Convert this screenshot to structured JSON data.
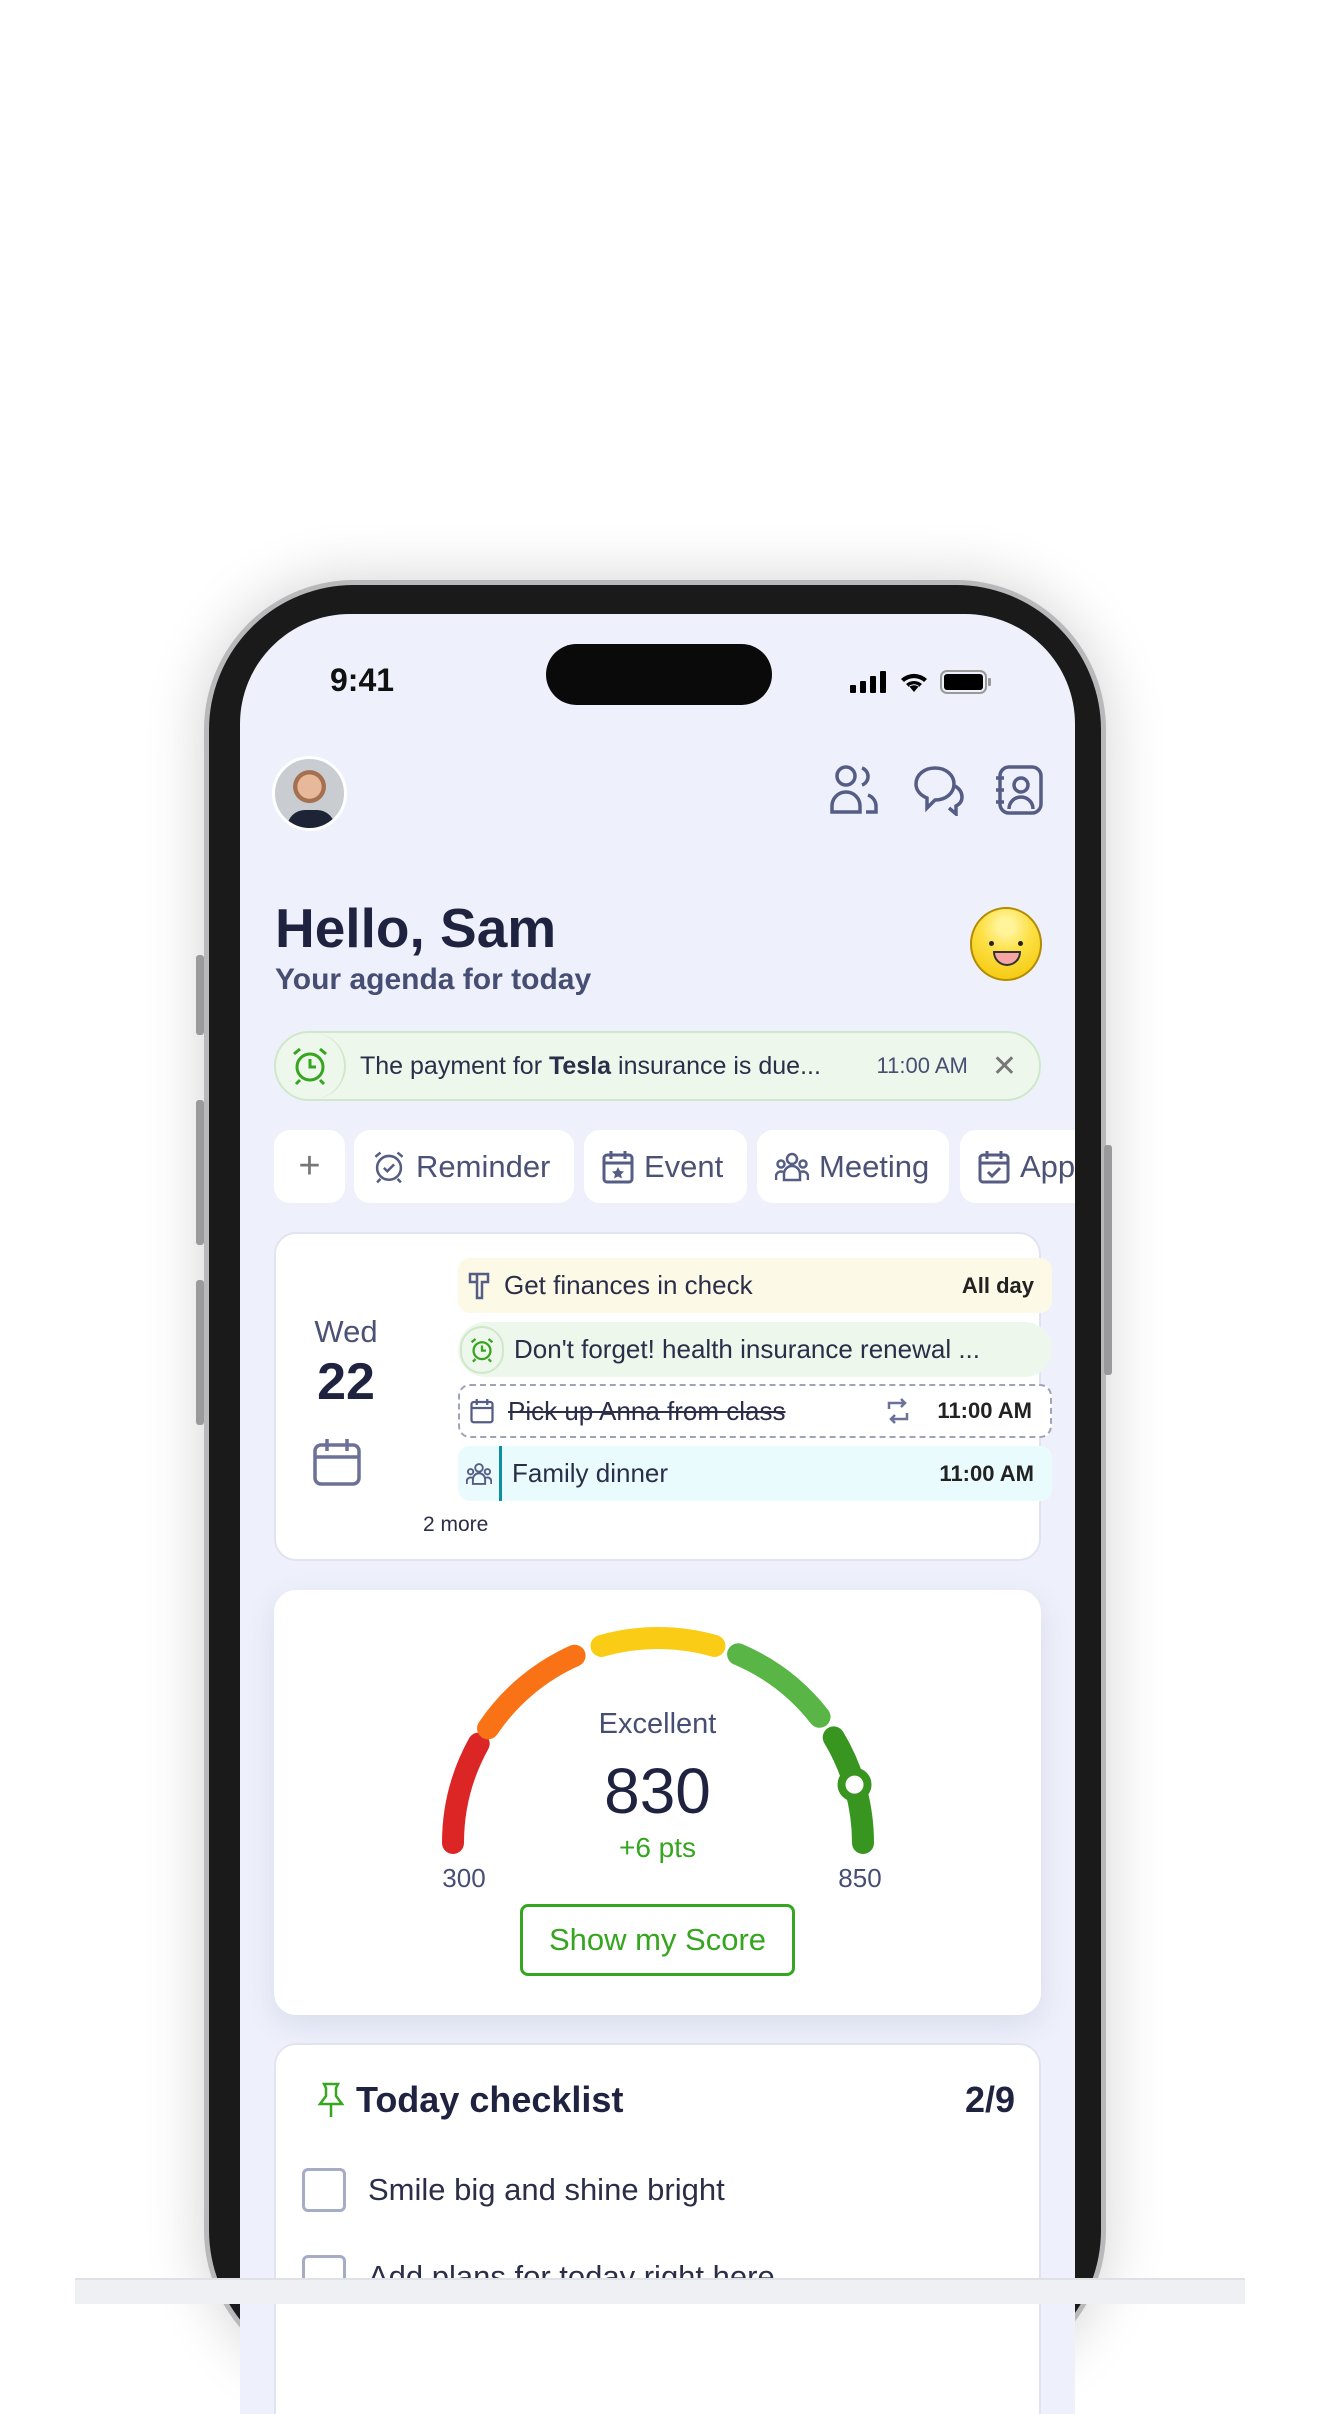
{
  "status": {
    "time": "9:41"
  },
  "header": {
    "greeting": "Hello, Sam",
    "subtitle": "Your agenda for today",
    "icons": [
      "contacts-icon",
      "chat-icon",
      "address-book-icon"
    ]
  },
  "banner": {
    "text_pre": "The payment for ",
    "text_bold": "Tesla",
    "text_post": " insurance is due...",
    "time": "11:00 AM"
  },
  "chips": [
    {
      "label": "+"
    },
    {
      "label": "Reminder",
      "icon": "alarm-icon"
    },
    {
      "label": "Event",
      "icon": "calendar-star-icon"
    },
    {
      "label": "Meeting",
      "icon": "group-icon"
    },
    {
      "label": "App",
      "icon": "calendar-check-icon"
    }
  ],
  "agenda": {
    "day": "Wed",
    "date": "22",
    "more": "2 more",
    "items": [
      {
        "label": "Get finances in check",
        "time": "All day",
        "bg": "#fdf9e7"
      },
      {
        "label": "Don't forget! health insurance renewal ...",
        "time": "",
        "bg": "#eef7ec"
      },
      {
        "label": "Pick up Anna from class",
        "time": "11:00 AM",
        "done": true
      },
      {
        "label": "Family dinner",
        "time": "11:00 AM",
        "bg": "#e9fbfd"
      }
    ]
  },
  "score": {
    "rating": "Excellent",
    "value": 830,
    "value_text": "830",
    "change": "+6 pts",
    "min": "300",
    "max": "850",
    "button": "Show my Score",
    "colors": [
      "#dc2626",
      "#f97316",
      "#facc15",
      "#5ab547",
      "#38951f"
    ]
  },
  "checklist": {
    "title": "Today checklist",
    "count": "2/9",
    "items": [
      "Smile big and shine bright",
      "Add plans for today right here"
    ]
  }
}
